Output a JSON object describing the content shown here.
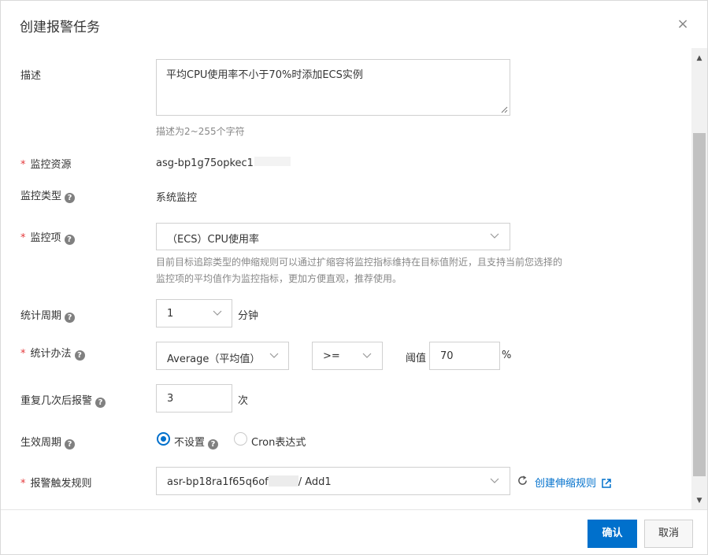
{
  "dialog": {
    "title": "创建报警任务",
    "close_icon": "×"
  },
  "form": {
    "description": {
      "label": "描述",
      "value": "平均CPU使用率不小于70%时添加ECS实例",
      "hint": "描述为2~255个字符"
    },
    "resource": {
      "required": "*",
      "label": "监控资源",
      "value": "asg-bp1g75opkec1"
    },
    "monitor_type": {
      "label": "监控类型",
      "value": "系统监控"
    },
    "metric": {
      "required": "*",
      "label": "监控项",
      "value": "（ECS）CPU使用率",
      "hint_line1": "目前目标追踪类型的伸缩规则可以通过扩缩容将监控指标维持在目标值附近，且支持当前您选择的",
      "hint_line2": "监控项的平均值作为监控指标，更加方便直观，推荐使用。"
    },
    "period": {
      "label": "统计周期",
      "value": "1",
      "unit": "分钟"
    },
    "method": {
      "required": "*",
      "label": "统计办法",
      "value": "Average（平均值）",
      "operator": ">=",
      "threshold_label": "阈值",
      "threshold": "70",
      "threshold_unit": "%"
    },
    "repeat": {
      "label": "重复几次后报警",
      "value": "3",
      "unit": "次"
    },
    "effective": {
      "label": "生效周期",
      "option_none": "不设置",
      "option_cron": "Cron表达式",
      "selected": "none"
    },
    "rule": {
      "required": "*",
      "label": "报警触发规则",
      "value_prefix": "asr-bp18ra1f65q6of",
      "value_suffix": "/ Add1",
      "create_link": "创建伸缩规则"
    }
  },
  "footer": {
    "confirm": "确认",
    "cancel": "取消"
  },
  "icons": {
    "help": "?",
    "chevron": "chevron-down-icon",
    "refresh": "⟳",
    "external": "external-link-icon"
  },
  "colors": {
    "primary": "#0070cc",
    "required": "#e4393c"
  }
}
